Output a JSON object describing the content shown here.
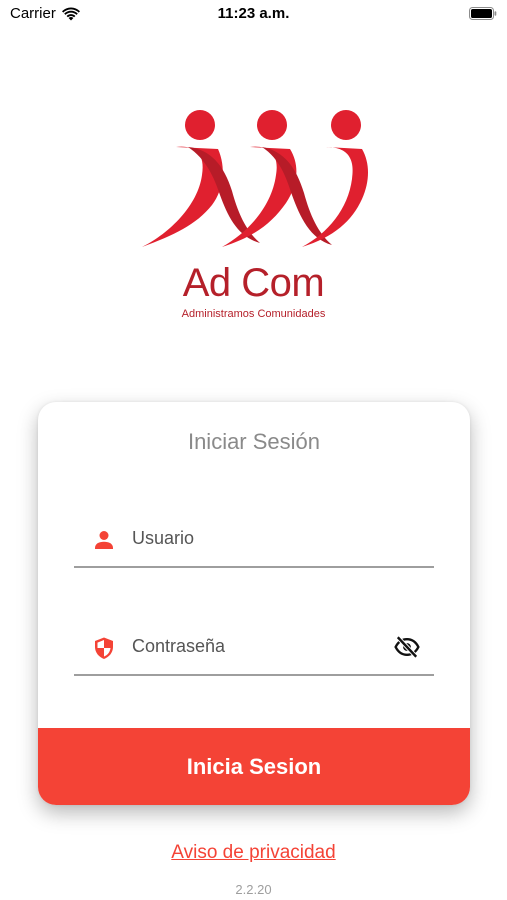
{
  "status_bar": {
    "carrier": "Carrier",
    "time": "11:23 a.m.",
    "wifi_icon": "wifi-icon",
    "battery_icon": "battery-icon"
  },
  "logo": {
    "name": "Ad Com",
    "tagline": "Administramos Comunidades",
    "mark_icon": "adcom-people-logo",
    "brand_color": "#e0202f"
  },
  "login": {
    "title": "Iniciar Sesión",
    "username": {
      "placeholder": "Usuario",
      "value": "",
      "icon": "user-icon"
    },
    "password": {
      "placeholder": "Contraseña",
      "value": "",
      "icon": "shield-icon",
      "toggle_icon": "eye-off-icon"
    },
    "submit_label": "Inicia Sesion"
  },
  "footer": {
    "privacy_link": "Aviso de privacidad",
    "version": "2.2.20"
  },
  "colors": {
    "accent": "#f44336",
    "title_text": "#8a8a8a",
    "underline": "#9e9e9e"
  }
}
